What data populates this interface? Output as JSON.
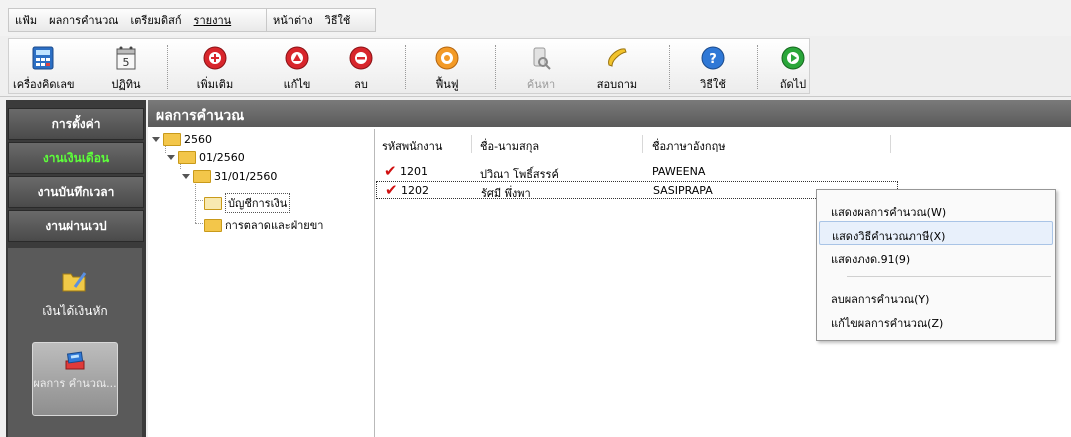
{
  "menu": {
    "group1": [
      "แฟ้ม",
      "ผลการคำนวณ",
      "เตรียมดิสก์",
      "รายงาน"
    ],
    "group2": [
      "หน้าต่าง",
      "วิธีใช้"
    ]
  },
  "toolbar": {
    "calculator": "เครื่องคิดเลข",
    "calendar": "ปฏิทิน",
    "add": "เพิ่มเติม",
    "edit": "แก้ไข",
    "delete": "ลบ",
    "restore": "ฟื้นฟู",
    "search": "ค้นหา",
    "inquiry": "สอบถาม",
    "help": "วิธีใช้",
    "next": "ถัดไป",
    "calendar_day": "5"
  },
  "nav": {
    "settings": "การตั้งค่า",
    "monthly": "งานเงินเดือน",
    "time": "งานบันทึกเวลา",
    "web": "งานผ่านเวป",
    "income": "เงินได้เงินหัก",
    "results": "ผลการ คำนวณ..."
  },
  "content": {
    "title": "ผลการคำนวณ"
  },
  "tree": {
    "year": "2560",
    "period": "01/2560",
    "date": "31/01/2560",
    "dept1": "บัญชีการเงิน",
    "dept2": "การตลาดและฝ่ายขา"
  },
  "grid": {
    "headers": [
      "รหัสพนักงาน",
      "ชื่อ-นามสกุล",
      "ชื่อภาษาอังกฤษ"
    ],
    "rows": [
      {
        "code": "1201",
        "name": "ปวิณา โพธิ์สรรค์",
        "english": "PAWEENA"
      },
      {
        "code": "1202",
        "name": "รัศมี พึ่งพา",
        "english": "SASIPRAPA"
      }
    ]
  },
  "context_menu": {
    "items": [
      "แสดงผลการคำนวณ(W)",
      "แสดงวิธีคำนวณภาษี(X)",
      "แสดงภงด.91(9)",
      "ลบผลการคำนวณ(Y)",
      "แก้ไขผลการคำนวณ(Z)"
    ]
  },
  "colors": {
    "nav_active": "#5dff3a",
    "check": "#d01010",
    "folder": "#f3c64a"
  }
}
